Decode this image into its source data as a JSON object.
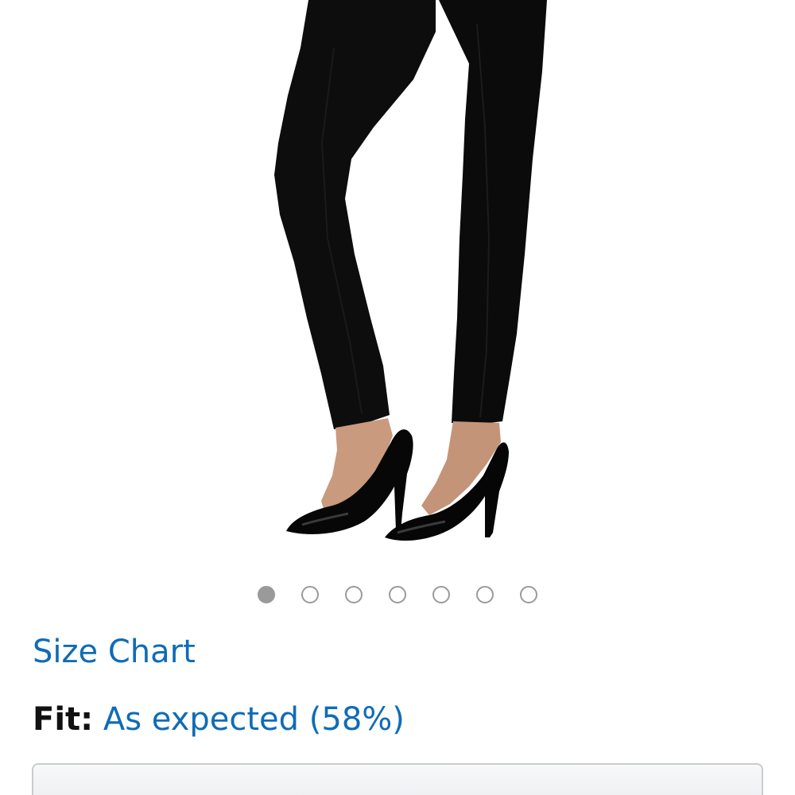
{
  "product": {
    "image_alt": "Black leggings worn with black patent stiletto pumps",
    "image_subject": "leggings-and-heels-photo"
  },
  "carousel": {
    "total": 7,
    "active_index": 0,
    "active_color": "#9a9a9a",
    "inactive_border_color": "#9a9a9a"
  },
  "links": {
    "size_chart": "Size Chart"
  },
  "fit": {
    "label": "Fit:",
    "value": "As expected (58%)",
    "percent": 58
  },
  "colors": {
    "link": "#0f6cb6",
    "text": "#111111",
    "background": "#ffffff"
  },
  "selector": {
    "value": ""
  }
}
